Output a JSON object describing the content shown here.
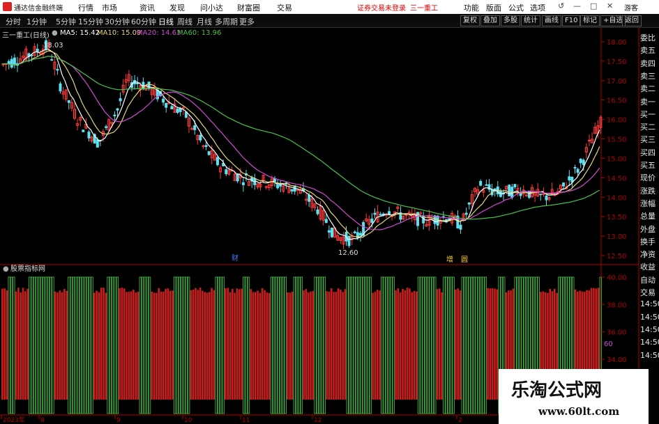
{
  "app": {
    "title": "通达信金融终端",
    "menus": [
      "行情",
      "市场",
      "资讯",
      "发现",
      "问小达",
      "财富圈",
      "交易"
    ],
    "warning": "证券交易未登录",
    "stock_name_header": "三一重工",
    "top_right": [
      "功能",
      "版面",
      "公式",
      "选项"
    ],
    "guest": "游客",
    "window_buttons": [
      "↺",
      "—",
      "□",
      "✕"
    ]
  },
  "period_tabs": [
    "分时",
    "1分钟",
    "5分钟",
    "15分钟",
    "30分钟",
    "60分钟",
    "日线",
    "周线",
    "月线",
    "多周期",
    "更多"
  ],
  "active_tab": "日线",
  "toolbar_buttons": [
    "复权",
    "叠加",
    "多股",
    "统计",
    "画线",
    "F10",
    "标记",
    "+自选",
    "返回"
  ],
  "indicator": {
    "label": "三一重工(日线)",
    "ma5": "MA5: 15.42",
    "ma10": "MA10: 15.09",
    "ma20": "MA20: 14.63",
    "ma60": "MA60: 13.96",
    "colors": {
      "ma5": "#ffffff",
      "ma10": "#e6d77a",
      "ma20": "#d24ad2",
      "ma60": "#49c24a"
    }
  },
  "price_axis": [
    "18.00",
    "17.50",
    "17.00",
    "16.50",
    "16.00",
    "15.50",
    "15.00",
    "14.50",
    "14.00",
    "13.50",
    "13.00",
    "12.50"
  ],
  "annotations": {
    "high": "18.03",
    "low": "12.60",
    "marker_cai": "财",
    "marker_zeng": "增",
    "marker_box": "圆"
  },
  "lower_panel": {
    "title": "股票指标网",
    "axis": [
      "40.00",
      "38.00",
      "36.00",
      "34.00"
    ],
    "side_value": "60"
  },
  "right_panel": [
    "委比",
    "卖五",
    "卖四",
    "卖三",
    "卖二",
    "卖一",
    "买一",
    "买二",
    "买三",
    "买四",
    "买五",
    "现价",
    "涨跌",
    "涨幅",
    "总量",
    "外盘",
    "换手",
    "净资",
    "收益",
    "自动",
    "交易",
    "14:50",
    "14:50",
    "14:50",
    "14:50",
    "14:50"
  ],
  "date_axis": [
    "2023年",
    "8",
    "9",
    "10",
    "11",
    "12",
    "2"
  ],
  "watermark": {
    "title": "乐淘公式网",
    "url": "www.60lt.com"
  },
  "colors": {
    "up": "#ff3b3b",
    "down": "#5ee0f0",
    "bar_red": "#c81e1e",
    "bar_green": "#3fb53f",
    "axis_red": "#b00000"
  }
}
